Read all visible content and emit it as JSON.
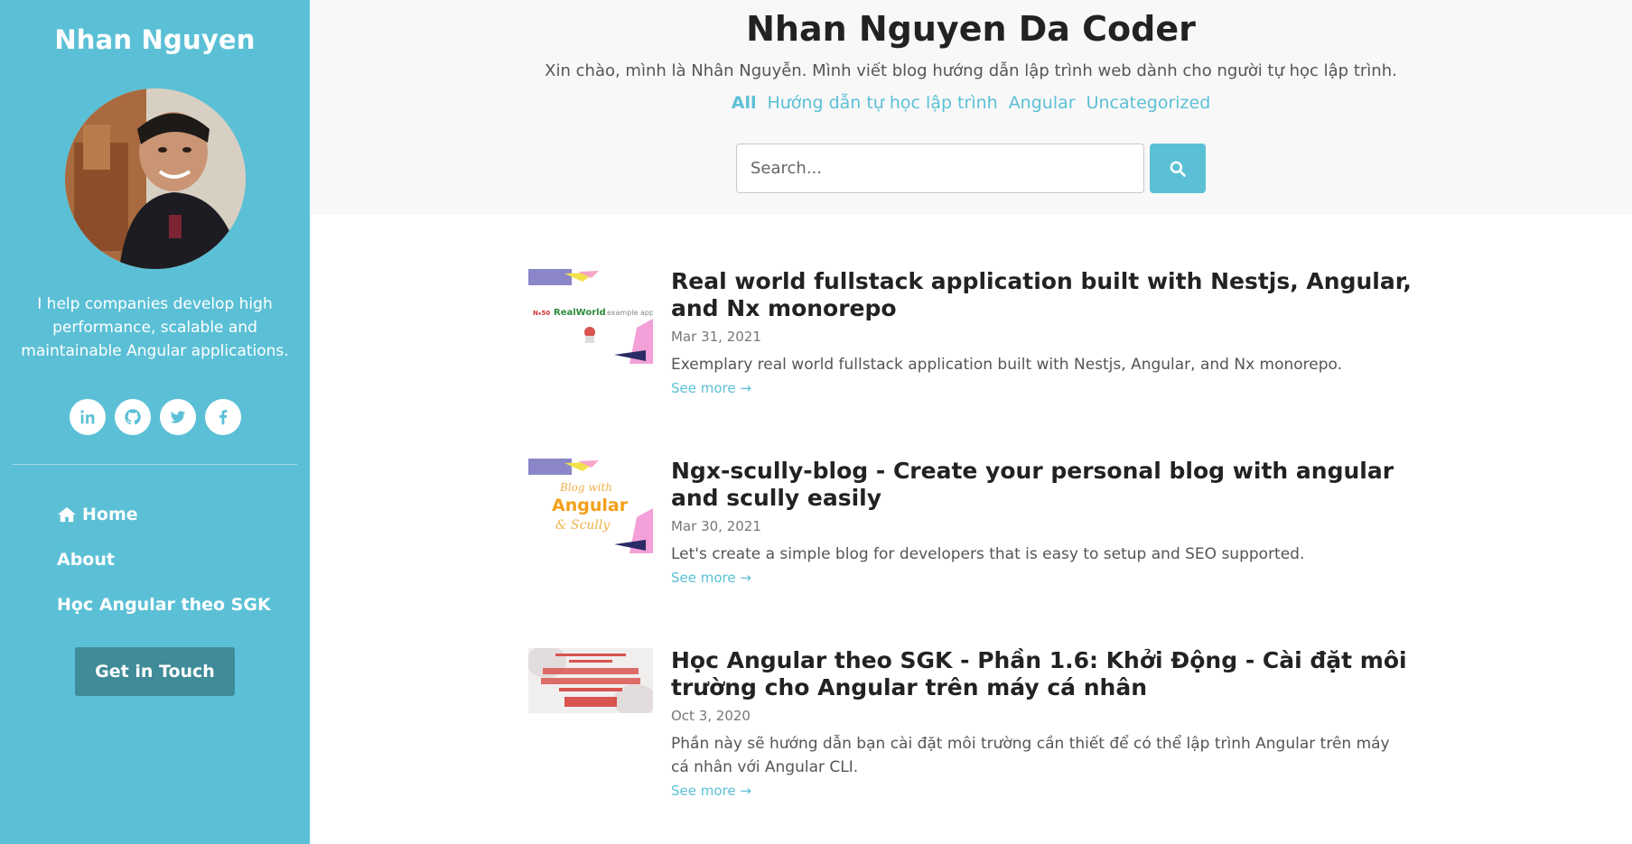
{
  "sidebar": {
    "brand": "Nhan Nguyen",
    "tagline": "I help companies develop high performance, scalable and maintainable Angular applications.",
    "socials": [
      {
        "icon": "linkedin-icon"
      },
      {
        "icon": "github-icon"
      },
      {
        "icon": "twitter-icon"
      },
      {
        "icon": "facebook-icon"
      }
    ],
    "nav": {
      "home": "Home",
      "about": "About",
      "hoc_angular": "Học Angular theo SGK"
    },
    "cta": "Get in Touch"
  },
  "header": {
    "title": "Nhan Nguyen Da Coder",
    "description": "Xin chào, mình là Nhân Nguyễn. Mình viết blog hướng dẫn lập trình web dành cho người tự học lập trình.",
    "categories": [
      "All",
      "Hướng dẫn tự học lập trình",
      "Angular",
      "Uncategorized"
    ],
    "search_placeholder": "Search..."
  },
  "posts": [
    {
      "title": "Real world fullstack application built with Nestjs, Angular, and Nx monorepo",
      "date": "Mar 31, 2021",
      "excerpt": "Exemplary real world fullstack application built with Nestjs, Angular, and Nx monorepo.",
      "see_more": "See more →",
      "thumb_text": "RealWorld",
      "thumb_sub": "example app"
    },
    {
      "title": "Ngx-scully-blog - Create your personal blog with angular and scully easily",
      "date": "Mar 30, 2021",
      "excerpt": "Let's create a simple blog for developers that is easy to setup and SEO supported.",
      "see_more": "See more →",
      "thumb_text": "Angular"
    },
    {
      "title": "Học Angular theo SGK - Phần 1.6: Khởi Động - Cài đặt môi trường cho Angular trên máy cá nhân",
      "date": "Oct 3, 2020",
      "excerpt": "Phần này sẽ hướng dẫn bạn cài đặt môi trường cần thiết để có thể lập trình Angular trên máy cá nhân với Angular CLI.",
      "see_more": "See more →"
    }
  ],
  "colors": {
    "accent": "#5bc0d6",
    "cta": "#3f8b98",
    "header_bg": "#f8f8f8"
  }
}
